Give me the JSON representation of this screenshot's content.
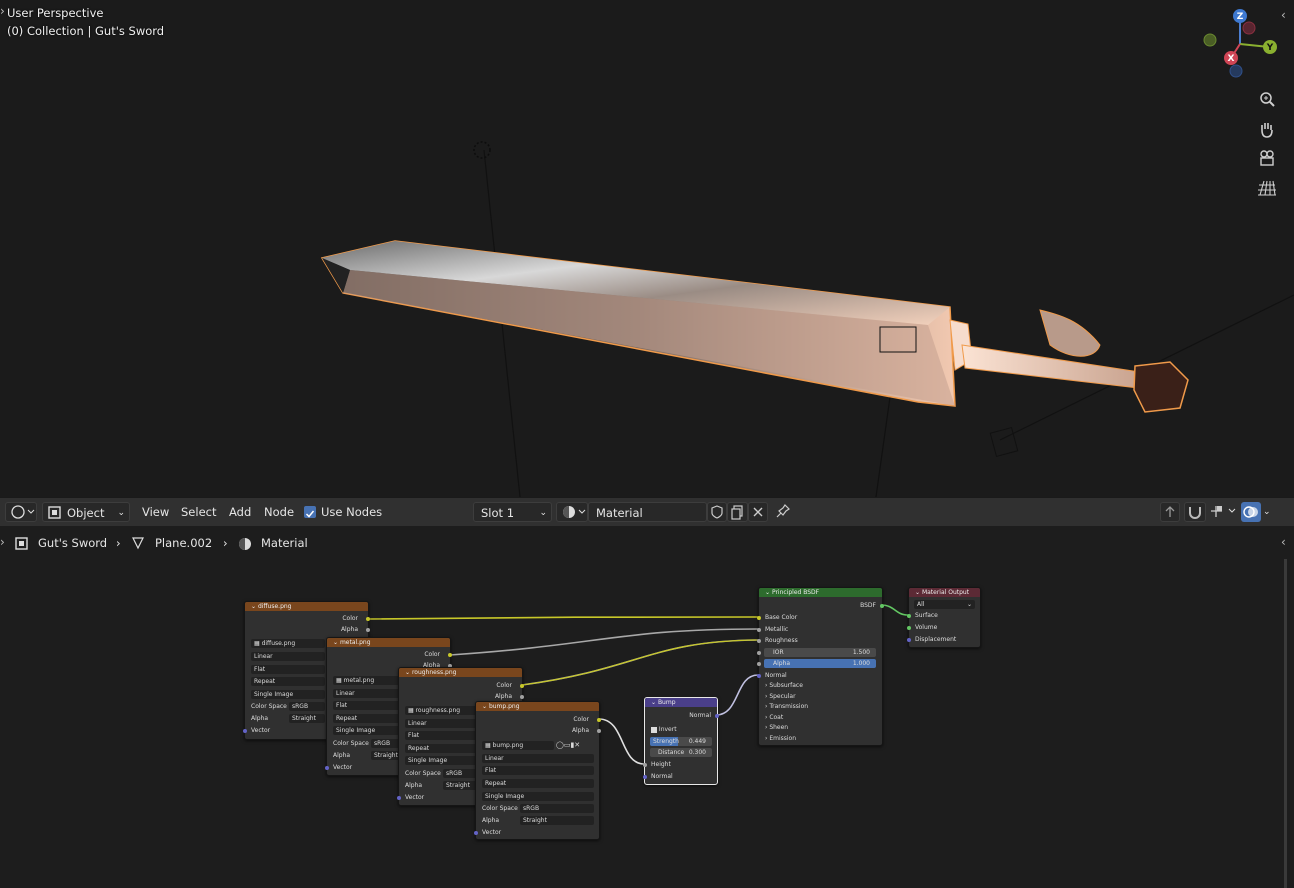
{
  "viewport": {
    "title": "User Perspective",
    "collection": "(0) Collection | Gut's Sword",
    "gizmo": {
      "x": "X",
      "y": "Y",
      "z": "Z"
    },
    "nav_icons": [
      "zoom-icon",
      "pan-hand-icon",
      "camera-icon",
      "grid-icon"
    ]
  },
  "header": {
    "mode": "Object",
    "menus": [
      "View",
      "Select",
      "Add",
      "Node"
    ],
    "use_nodes": "Use Nodes",
    "slot": "Slot 1",
    "material": "Material"
  },
  "breadcrumb": {
    "object": "Gut's Sword",
    "mesh": "Plane.002",
    "material": "Material"
  },
  "nodes": {
    "diffuse": {
      "title": "diffuse.png",
      "image": "diffuse.png",
      "interp": "Linear",
      "proj": "Flat",
      "ext": "Repeat",
      "source": "Single Image",
      "cs_label": "Color Space",
      "cs": "sRGB",
      "alpha_label": "Alpha",
      "alpha": "Straight",
      "vector": "Vector",
      "out_color": "Color",
      "out_alpha": "Alpha"
    },
    "metal": {
      "title": "metal.png",
      "image": "metal.png",
      "interp": "Linear",
      "proj": "Flat",
      "ext": "Repeat",
      "source": "Single Image",
      "cs_label": "Color Space",
      "cs": "sRGB",
      "alpha_label": "Alpha",
      "alpha": "Straight",
      "vector": "Vector",
      "out_color": "Color",
      "out_alpha": "Alpha"
    },
    "roughness": {
      "title": "roughness.png",
      "image": "roughness.png",
      "interp": "Linear",
      "proj": "Flat",
      "ext": "Repeat",
      "source": "Single Image",
      "cs_label": "Color Space",
      "cs": "sRGB",
      "alpha_label": "Alpha",
      "alpha": "Straight",
      "vector": "Vector",
      "out_color": "Color",
      "out_alpha": "Alpha"
    },
    "bumpimg": {
      "title": "bump.png",
      "image": "bump.png",
      "interp": "Linear",
      "proj": "Flat",
      "ext": "Repeat",
      "source": "Single Image",
      "cs_label": "Color Space",
      "cs": "sRGB",
      "alpha_label": "Alpha",
      "alpha": "Straight",
      "vector": "Vector",
      "out_color": "Color",
      "out_alpha": "Alpha"
    },
    "bump": {
      "title": "Bump",
      "out_normal": "Normal",
      "invert": "Invert",
      "strength_label": "Strength",
      "strength": "0.449",
      "distance_label": "Distance",
      "distance": "0.300",
      "height": "Height",
      "normal": "Normal"
    },
    "bsdf": {
      "title": "Principled BSDF",
      "out": "BSDF",
      "base_color": "Base Color",
      "metallic": "Metallic",
      "roughness": "Roughness",
      "ior_label": "IOR",
      "ior": "1.500",
      "alpha_label": "Alpha",
      "alpha": "1.000",
      "normal": "Normal",
      "panels": [
        "Subsurface",
        "Specular",
        "Transmission",
        "Coat",
        "Sheen",
        "Emission"
      ]
    },
    "output": {
      "title": "Material Output",
      "target": "All",
      "surface": "Surface",
      "volume": "Volume",
      "displacement": "Displacement"
    }
  },
  "colors": {
    "texture_header": "#79461d",
    "bsdf_header": "#2d6b2d",
    "output_header": "#5c2a35",
    "bump_header": "#4a3f8a",
    "selection": "#f09a4a"
  }
}
